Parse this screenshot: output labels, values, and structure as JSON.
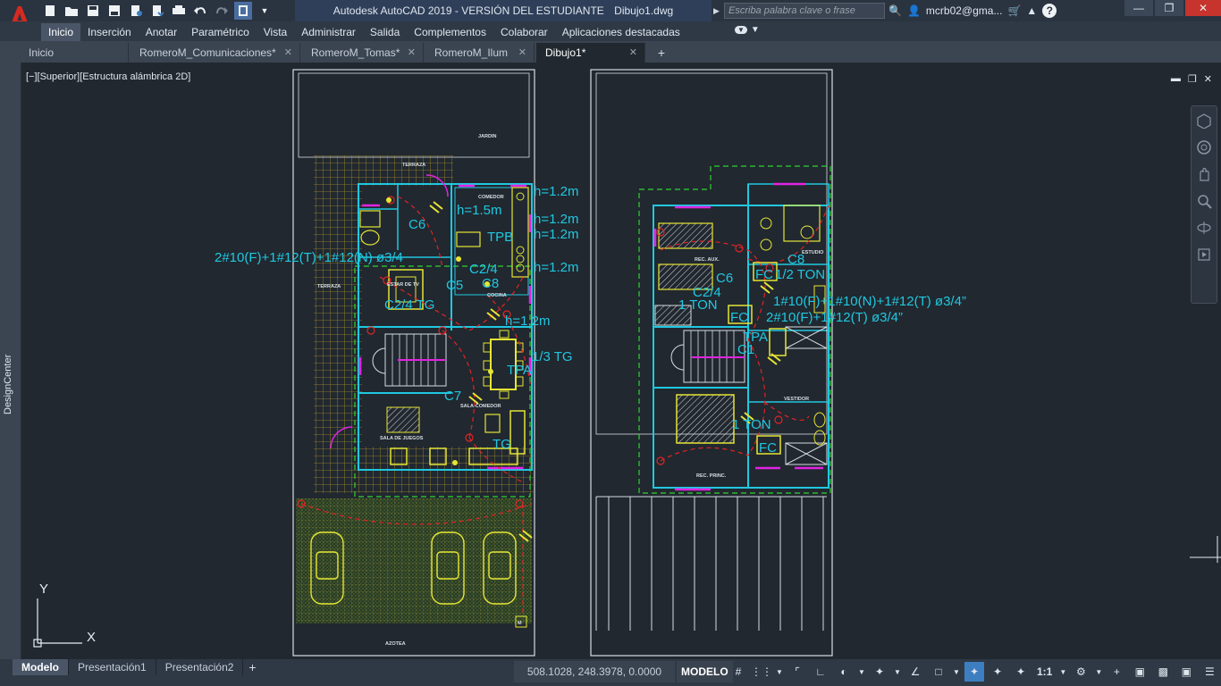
{
  "titlebar": {
    "app_title": "Autodesk AutoCAD 2019 - VERSIÓN DEL ESTUDIANTE",
    "file_name": "Dibujo1.dwg",
    "search_placeholder": "Escriba palabra clave o frase",
    "user_name": "mcrb02@gma...",
    "app_logo_letter": "A"
  },
  "ribbon": {
    "tabs": [
      "Inicio",
      "Inserción",
      "Anotar",
      "Paramétrico",
      "Vista",
      "Administrar",
      "Salida",
      "Complementos",
      "Colaborar",
      "Aplicaciones destacadas"
    ],
    "active_tab": "Inicio"
  },
  "doc_tabs": {
    "tabs": [
      "Inicio",
      "RomeroM_Comunicaciones*",
      "RomeroM_Tomas*",
      "RomeroM_Ilum",
      "Dibujo1*"
    ],
    "active_tab": "Dibujo1*"
  },
  "side_panel": {
    "label": "DesignCenter"
  },
  "viewport": {
    "label": "[−][Superior][Estructura alámbrica 2D]",
    "ucs_x": "X",
    "ucs_y": "Y"
  },
  "drawing": {
    "annotations": [
      "h=1.2m",
      "h=1.5m",
      "h=1.2m",
      "h=1.2m",
      "h=1.2m",
      "h=1.2m",
      "C6",
      "TPB",
      "2#10(F)+1#12(T)+1#12(N) ø3/4",
      "C2/4",
      "C5",
      "C8",
      "C2/4  TG",
      "1/3  TG",
      "TPA",
      "C7",
      "TG",
      "C8",
      "FC",
      "1/2  TON",
      "C6",
      "C2/4",
      "1  TON",
      "FC",
      "1#10(F)+1#10(N)+1#12(T)  ø3/4”",
      "2#10(F)+1#12(T)  ø3/4”",
      "C1",
      "TPA",
      "1  TON",
      "FC"
    ],
    "room_labels": [
      "JARDIN",
      "TERRAZA",
      "COMEDOR",
      "TERRAZA",
      "ESTAR DE TV",
      "COCINA",
      "SALA-COMEDOR",
      "SALA DE JUEGOS",
      "AZOTEA",
      "REC. AUX.",
      "ESTUDIO",
      "VESTIDOR",
      "REC. PRINC.",
      "M"
    ]
  },
  "layout_tabs": {
    "tabs": [
      "Modelo",
      "Presentación1",
      "Presentación2"
    ],
    "active_tab": "Modelo"
  },
  "statusbar": {
    "coordinates": "508.1028, 248.3978, 0.0000",
    "mode": "MODELO",
    "scale": "1:1"
  },
  "colors": {
    "background": "#212830",
    "accent": "#3d7ec1",
    "cyan": "#20c8e0",
    "yellow": "#e6e635",
    "green": "#31d331",
    "red": "#e02424",
    "magenta": "#e024e0"
  }
}
